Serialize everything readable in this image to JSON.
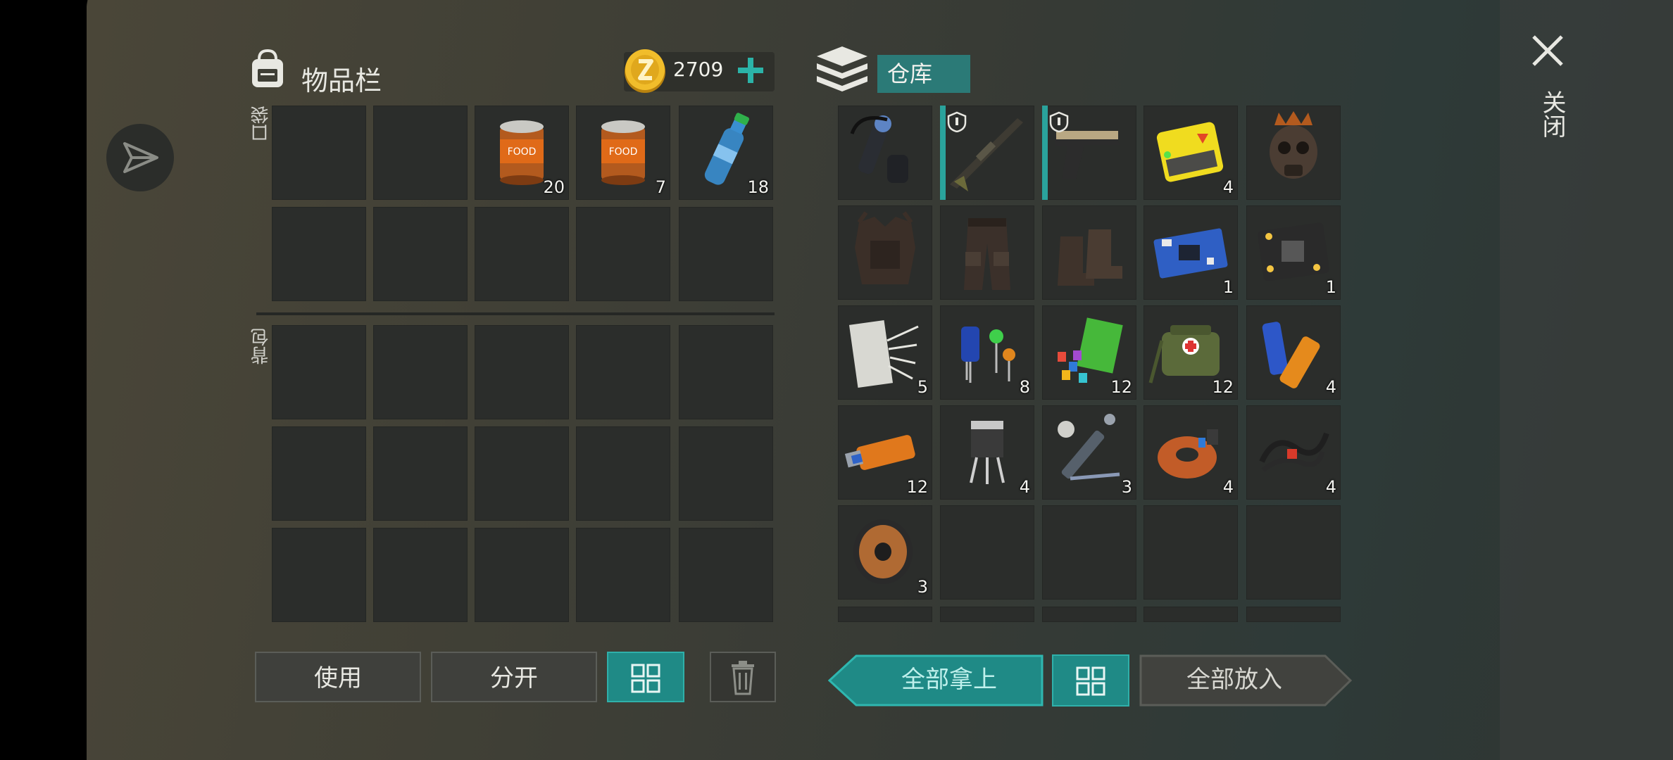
{
  "inventory": {
    "title": "物品栏",
    "coins": "2709",
    "pocket_label": "口袋",
    "backpack_label": "背包",
    "pocket_slots": [
      {
        "item": "",
        "count": ""
      },
      {
        "item": "",
        "count": ""
      },
      {
        "item": "canned-food",
        "count": "20"
      },
      {
        "item": "canned-food",
        "count": "7"
      },
      {
        "item": "water-bottle",
        "count": "18"
      },
      {
        "item": "",
        "count": ""
      },
      {
        "item": "",
        "count": ""
      },
      {
        "item": "",
        "count": ""
      },
      {
        "item": "",
        "count": ""
      },
      {
        "item": "",
        "count": ""
      }
    ],
    "buttons": {
      "use": "使用",
      "split": "分开"
    }
  },
  "warehouse": {
    "title": "仓库",
    "slots": [
      {
        "item": "silencer-flashlight",
        "count": ""
      },
      {
        "item": "rifle",
        "count": "",
        "locked": true
      },
      {
        "item": "pistol",
        "count": "",
        "locked": true
      },
      {
        "item": "battery-pack",
        "count": "4"
      },
      {
        "item": "skull-mask",
        "count": ""
      },
      {
        "item": "armor-vest",
        "count": ""
      },
      {
        "item": "armor-pants",
        "count": ""
      },
      {
        "item": "armor-boots",
        "count": ""
      },
      {
        "item": "circuit-board-blue",
        "count": "1"
      },
      {
        "item": "circuit-board-black",
        "count": "1"
      },
      {
        "item": "cloth-fibers",
        "count": "5"
      },
      {
        "item": "capacitors",
        "count": "8"
      },
      {
        "item": "electronic-parts",
        "count": "12"
      },
      {
        "item": "first-aid-bag",
        "count": "12"
      },
      {
        "item": "batteries",
        "count": "4"
      },
      {
        "item": "usb-drive",
        "count": "12"
      },
      {
        "item": "transistor",
        "count": "4"
      },
      {
        "item": "tools-kit",
        "count": "3"
      },
      {
        "item": "copper-coil",
        "count": "4"
      },
      {
        "item": "cable",
        "count": "4"
      },
      {
        "item": "wire-spool",
        "count": "3"
      }
    ],
    "buttons": {
      "take_all": "全部拿上",
      "put_all": "全部放入"
    }
  },
  "close_label": "关闭",
  "colors": {
    "accent": "#1f8a86",
    "mark": "#2aa39c"
  }
}
